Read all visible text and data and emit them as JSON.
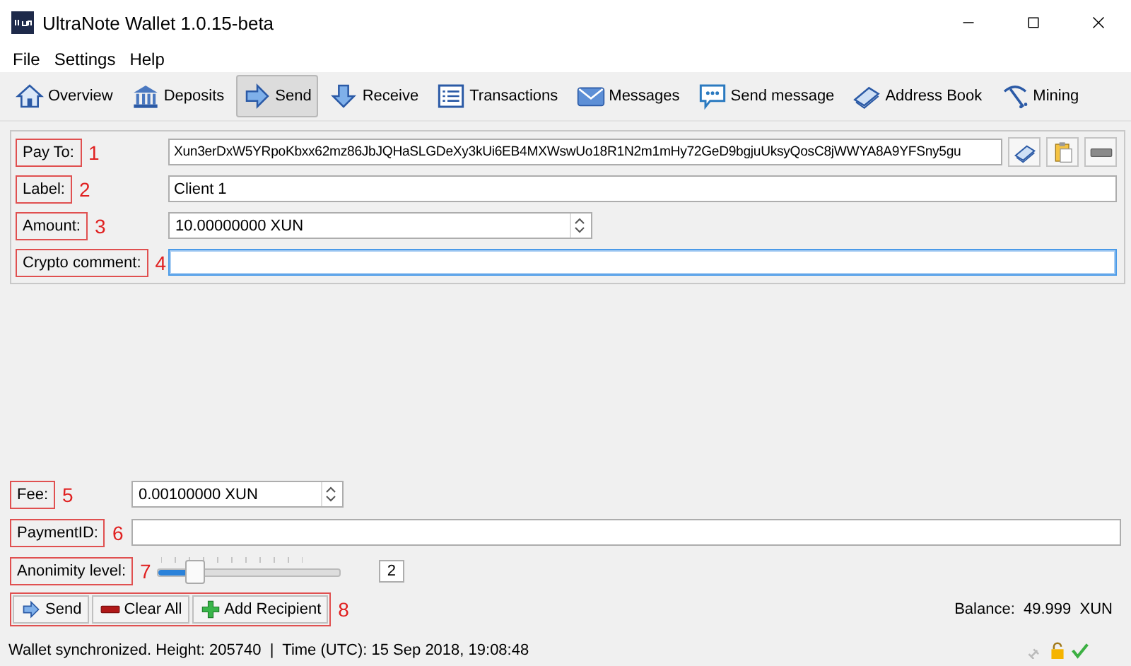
{
  "window": {
    "title": "UltraNote Wallet 1.0.15-beta"
  },
  "menu": [
    "File",
    "Settings",
    "Help"
  ],
  "toolbar": [
    {
      "label": "Overview",
      "selected": false
    },
    {
      "label": "Deposits",
      "selected": false
    },
    {
      "label": "Send",
      "selected": true
    },
    {
      "label": "Receive",
      "selected": false
    },
    {
      "label": "Transactions",
      "selected": false
    },
    {
      "label": "Messages",
      "selected": false
    },
    {
      "label": "Send message",
      "selected": false
    },
    {
      "label": "Address Book",
      "selected": false
    },
    {
      "label": "Mining",
      "selected": false
    }
  ],
  "recipient": [
    {
      "label": "Pay To:",
      "callout": "1",
      "kind": "address",
      "value": "Xun3erDxW5YRpoKbxx62mz86JbJQHaSLGDeXy3kUi6EB4MXWswUo18R1N2m1mHy72GeD9bgjuUksyQosC8jWWYA8A9YFSny5gu",
      "focused": false
    },
    {
      "label": "Label:",
      "callout": "2",
      "kind": "text",
      "value": "Client 1",
      "focused": false
    },
    {
      "label": "Amount:",
      "callout": "3",
      "kind": "spin",
      "value": "10.00000000 XUN",
      "focused": false
    },
    {
      "label": "Crypto comment:",
      "callout": "4",
      "kind": "text",
      "focused": true
    }
  ],
  "fee": {
    "label": "Fee:",
    "callout": "5",
    "value": "0.00100000 XUN"
  },
  "payment_id": {
    "label": "PaymentID:",
    "callout": "6"
  },
  "anonymity": {
    "label": "Anonimity level:",
    "callout": "7",
    "level": 0.2,
    "reading": "2"
  },
  "actions": {
    "callout": "8",
    "buttons": [
      "Send",
      "Clear All",
      "Add Recipient"
    ]
  },
  "balance": "Balance:  49.999  XUN",
  "status_bar": {
    "text": "Wallet synchronized. Height: 205740  |  Time (UTC): 15 Sep 2018, 19:08:48"
  }
}
